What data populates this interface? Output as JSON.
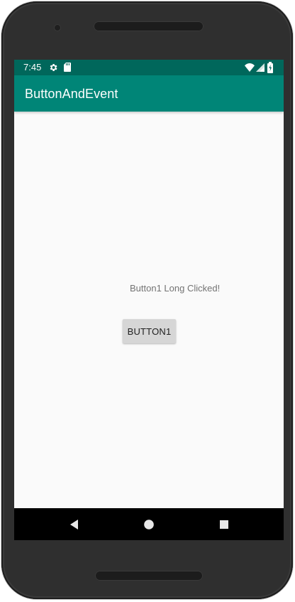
{
  "status_bar": {
    "time": "7:45",
    "settings_icon": "settings-icon",
    "sdcard_icon": "sdcard-icon",
    "wifi_icon": "wifi-icon",
    "signal_icon": "signal-icon",
    "battery_icon": "battery-icon"
  },
  "app_bar": {
    "title": "ButtonAndEvent"
  },
  "content": {
    "message": "Button1 Long Clicked!",
    "button_label": "BUTTON1"
  },
  "navigation": {
    "back_icon": "back-icon",
    "home_icon": "home-icon",
    "recents_icon": "recents-icon"
  },
  "colors": {
    "status_bar": "#00675b",
    "app_bar": "#008577",
    "screen_background": "#fafafa",
    "button_background": "#d6d6d6",
    "navigation_bar": "#000000"
  }
}
